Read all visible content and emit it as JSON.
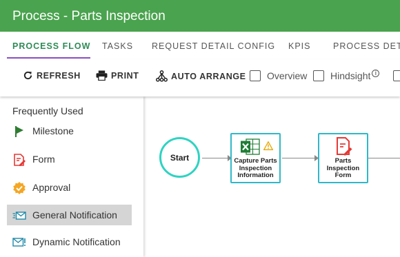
{
  "window": {
    "title": "Process - Parts Inspection"
  },
  "tabs": [
    {
      "label": "PROCESS FLOW",
      "active": true
    },
    {
      "label": "TASKS",
      "active": false
    },
    {
      "label": "REQUEST DETAIL CONFIG",
      "active": false
    },
    {
      "label": "KPIS",
      "active": false
    },
    {
      "label": "PROCESS DETA",
      "active": false
    }
  ],
  "toolbar": {
    "refresh_label": "REFRESH",
    "print_label": "PRINT",
    "auto_arrange_label": "AUTO ARRANGE",
    "overview_label": "Overview",
    "overview_checked": false,
    "hindsight_label": "Hindsight",
    "hindsight_checked": false,
    "info_glyph": "i"
  },
  "palette": {
    "heading": "Frequently Used",
    "items": [
      {
        "label": "Milestone",
        "icon": "flag-icon",
        "selected": false
      },
      {
        "label": "Form",
        "icon": "form-icon",
        "selected": false
      },
      {
        "label": "Approval",
        "icon": "approval-badge-icon",
        "selected": false
      },
      {
        "label": "General Notification",
        "icon": "mail-notification-icon",
        "selected": true
      },
      {
        "label": "Dynamic Notification",
        "icon": "mail-dynamic-icon",
        "selected": false
      }
    ]
  },
  "flow": {
    "start_label": "Start",
    "nodes": [
      {
        "label_lines": [
          "Capture Parts",
          "Inspection",
          "Information"
        ],
        "icon": "excel-icon",
        "warning": true
      },
      {
        "label_lines": [
          "Parts",
          "Inspection",
          "Form"
        ],
        "icon": "form-icon",
        "warning": false
      }
    ]
  },
  "colors": {
    "header": "#4aa34e",
    "active_tab_text": "#2e8b57",
    "active_tab_underline": "#8a4fc0",
    "start_border": "#2fd3c2",
    "node_border": "#2fb8c9",
    "selected_item_bg": "#d5d5d5"
  }
}
